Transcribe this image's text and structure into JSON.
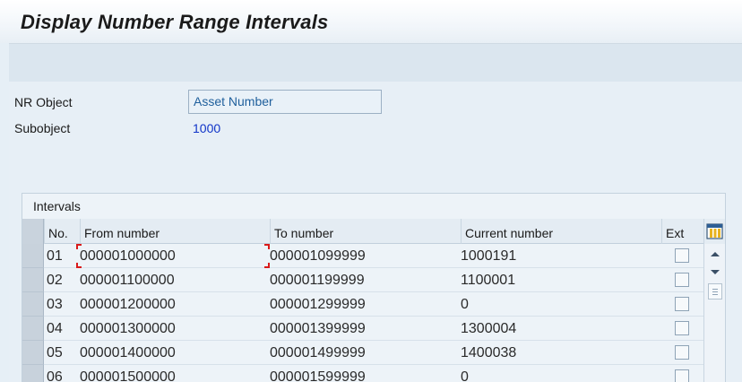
{
  "header": {
    "title": "Display Number Range Intervals"
  },
  "fields": {
    "nr_object_label": "NR Object",
    "nr_object_value": "Asset Number",
    "subobject_label": "Subobject",
    "subobject_value": "1000"
  },
  "intervals": {
    "title": "Intervals",
    "columns": [
      "No.",
      "From number",
      "To number",
      "Current number",
      "Ext"
    ],
    "rows": [
      {
        "no": "01",
        "from": "000001000000",
        "to": "000001099999",
        "current": "1000191",
        "ext": false
      },
      {
        "no": "02",
        "from": "000001100000",
        "to": "000001199999",
        "current": "1100001",
        "ext": false
      },
      {
        "no": "03",
        "from": "000001200000",
        "to": "000001299999",
        "current": "0",
        "ext": false
      },
      {
        "no": "04",
        "from": "000001300000",
        "to": "000001399999",
        "current": "1300004",
        "ext": false
      },
      {
        "no": "05",
        "from": "000001400000",
        "to": "000001499999",
        "current": "1400038",
        "ext": false
      },
      {
        "no": "06",
        "from": "000001500000",
        "to": "000001599999",
        "current": "0",
        "ext": false
      }
    ]
  },
  "icons": {
    "column_settings": "column-settings-icon",
    "scroll_up": "scroll-up-icon",
    "scroll_down": "scroll-down-icon",
    "scroll_grip": "scroll-grip-icon"
  },
  "colors": {
    "value_blue": "#1034c8",
    "input_text": "#1f5f9c",
    "focus_red": "#d91a1a"
  }
}
